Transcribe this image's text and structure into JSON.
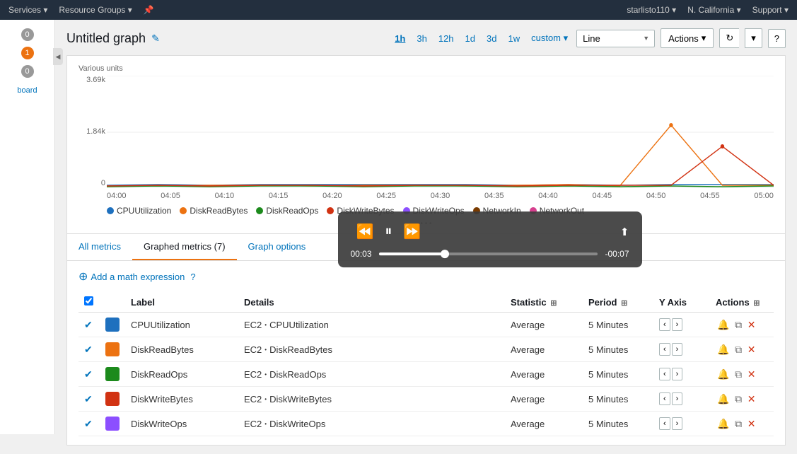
{
  "topnav": {
    "items": [
      "Services",
      "Resource Groups",
      "pin",
      "starlisto110",
      "N. California",
      "Support"
    ]
  },
  "sidebar": {
    "toggleLabel": "◀",
    "badges": [
      {
        "value": "0",
        "color": "gray"
      },
      {
        "value": "1",
        "color": "orange"
      },
      {
        "value": "0",
        "color": "gray"
      }
    ],
    "boardLabel": "board"
  },
  "header": {
    "title": "Untitled graph",
    "editIcon": "✎",
    "timeOptions": [
      "1h",
      "3h",
      "12h",
      "1d",
      "3d",
      "1w",
      "custom ▾"
    ],
    "activeTime": "1h",
    "chartType": "Line",
    "actionsLabel": "Actions",
    "refreshIcon": "↻",
    "dropdownIcon": "▾",
    "helpIcon": "?"
  },
  "graph": {
    "yLabel": "Various units",
    "yValues": [
      "3.69k",
      "1.84k",
      "0"
    ],
    "xValues": [
      "04:00",
      "04:05",
      "04:10",
      "04:15",
      "04:20",
      "04:25",
      "04:30",
      "04:35",
      "04:40",
      "04:45",
      "04:50",
      "04:55",
      "05:00"
    ],
    "legend": [
      {
        "name": "CPUUtilization",
        "color": "#1e70be"
      },
      {
        "name": "DiskReadBytes",
        "color": "#ec7211"
      },
      {
        "name": "DiskReadOps",
        "color": "#1c8a1c"
      },
      {
        "name": "DiskWriteBytes",
        "color": "#d13212"
      },
      {
        "name": "DiskWriteOps",
        "color": "#8c4fff"
      },
      {
        "name": "NetworkIn",
        "color": "#7a3b00"
      },
      {
        "name": "NetworkOut",
        "color": "#d63f8e"
      }
    ]
  },
  "tabs": {
    "items": [
      "All metrics",
      "Graphed metrics (7)",
      "Graph options"
    ],
    "active": 1
  },
  "addMath": {
    "label": "Add a math expression",
    "plusIcon": "⊕",
    "helpIcon": "?"
  },
  "tableHeaders": {
    "check": "",
    "color": "",
    "label": "Label",
    "details": "Details",
    "statistic": "Statistic",
    "statisticIcon": "⊞",
    "period": "Period",
    "periodIcon": "⊞",
    "yaxis": "Y Axis",
    "actions": "Actions",
    "actionsIcon": "⊞"
  },
  "rows": [
    {
      "checked": true,
      "color": "#1e70be",
      "label": "CPUUtilization",
      "detailPrefix": "EC2",
      "detailName": "CPUUtilization",
      "statistic": "Average",
      "period": "5 Minutes",
      "hasNavArrows": true,
      "actions": [
        "🔔",
        "⧉",
        "✕"
      ]
    },
    {
      "checked": true,
      "color": "#ec7211",
      "label": "DiskReadBytes",
      "detailPrefix": "EC2",
      "detailName": "DiskReadBytes",
      "statistic": "Average",
      "period": "5 Minutes",
      "hasNavArrows": true,
      "actions": [
        "🔔",
        "⧉",
        "✕"
      ]
    },
    {
      "checked": true,
      "color": "#1c8a1c",
      "label": "DiskReadOps",
      "detailPrefix": "EC2",
      "detailName": "DiskReadOps",
      "statistic": "Average",
      "period": "5 Minutes",
      "hasNavArrows": true,
      "actions": [
        "🔔",
        "⧉",
        "✕"
      ]
    },
    {
      "checked": true,
      "color": "#d13212",
      "label": "DiskWriteBytes",
      "detailPrefix": "EC2",
      "detailName": "DiskWriteBytes",
      "statistic": "Average",
      "period": "5 Minutes",
      "hasNavArrows": true,
      "actions": [
        "🔔",
        "⧉",
        "✕"
      ]
    },
    {
      "checked": true,
      "color": "#8c4fff",
      "label": "DiskWriteOps",
      "detailPrefix": "EC2",
      "detailName": "DiskWriteOps",
      "statistic": "Average",
      "period": "5 Minutes",
      "hasNavArrows": true,
      "actions": [
        "🔔",
        "⧉",
        "✕"
      ]
    }
  ],
  "videoPlayer": {
    "rewindIcon": "⏪",
    "pauseIcon": "⏸",
    "forwardIcon": "⏩",
    "shareIcon": "⬆",
    "currentTime": "00:03",
    "remainingTime": "-00:07",
    "progressPercent": 30
  }
}
